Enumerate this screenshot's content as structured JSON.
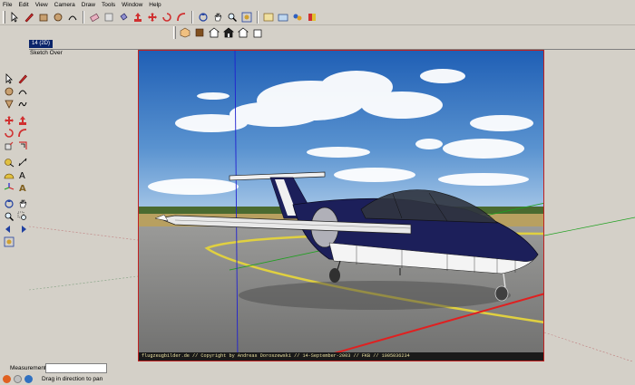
{
  "menu": [
    "File",
    "Edit",
    "View",
    "Camera",
    "Draw",
    "Tools",
    "Window",
    "Help"
  ],
  "toolbar": {
    "row1_icons": [
      "select-icon",
      "pencil-icon",
      "rectangle-icon",
      "circle-icon",
      "arc-icon",
      "eraser-icon",
      "make-component-icon",
      "paint-bucket-icon",
      "push-pull-icon",
      "move-icon",
      "rotate-icon",
      "follow-me-icon",
      "orbit-icon",
      "pan-icon",
      "zoom-icon",
      "zoom-extents-icon",
      "get-models-icon",
      "share-model-icon",
      "components-icon",
      "materials-icon"
    ],
    "row2_icons": [
      "iso-view-icon",
      "top-view-icon",
      "front-view-icon",
      "right-view-icon",
      "back-view-icon",
      "left-view-icon"
    ]
  },
  "scene_tab": "14 (2D)",
  "sketch_label": "Sketch Over",
  "photo_credit": "flugzeugbilder.de // Copyright by Andreas Doroszewski // 14-September-2003 // FKB // 1005036234",
  "status": {
    "measurements_label": "Measurements",
    "measurements_value": "",
    "hint": "Drag in direction to pan"
  },
  "colors": {
    "chrome": "#d4d0c8",
    "tab_active": "#0a246a",
    "axis_red": "#d02020",
    "axis_green": "#20a020",
    "axis_blue": "#2020d0",
    "aircraft_body": "#1c1f5a"
  }
}
